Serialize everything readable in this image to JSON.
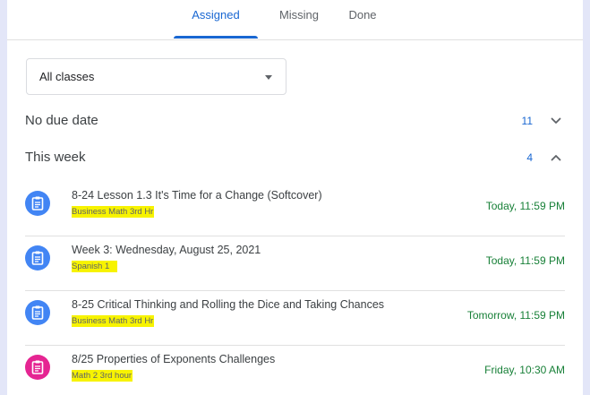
{
  "tabs": [
    {
      "label": "Assigned",
      "active": true
    },
    {
      "label": "Missing",
      "active": false
    },
    {
      "label": "Done",
      "active": false
    }
  ],
  "class_filter": {
    "selected": "All classes"
  },
  "sections": {
    "no_due_date": {
      "title": "No due date",
      "count": "11",
      "expanded": false
    },
    "this_week": {
      "title": "This week",
      "count": "4",
      "expanded": true
    }
  },
  "assignments": [
    {
      "title": "8-24 Lesson 1.3 It's Time for a Change (Softcover)",
      "class": "Business Math 3rd Hr",
      "due": "Today, 11:59 PM",
      "icon": "assignment-icon",
      "icon_color": "#4285f4"
    },
    {
      "title": "Week 3: Wednesday, August 25, 2021",
      "class": "Spanish 1   ",
      "due": "Today, 11:59 PM",
      "icon": "assignment-icon",
      "icon_color": "#4285f4"
    },
    {
      "title": "8-25 Critical Thinking and Rolling the Dice and Taking Chances",
      "class": "Business Math 3rd Hr",
      "due": "Tomorrow, 11:59 PM",
      "icon": "assignment-icon",
      "icon_color": "#4285f4"
    },
    {
      "title": "8/25 Properties of Exponents Challenges",
      "class": "Math 2 3rd hour",
      "due": "Friday, 10:30 AM",
      "icon": "assignment-icon",
      "icon_color": "#e52592"
    }
  ],
  "colors": {
    "accent": "#1967d2",
    "due": "#188038",
    "highlight": "#f7f300",
    "background": "#e3e6f8"
  }
}
